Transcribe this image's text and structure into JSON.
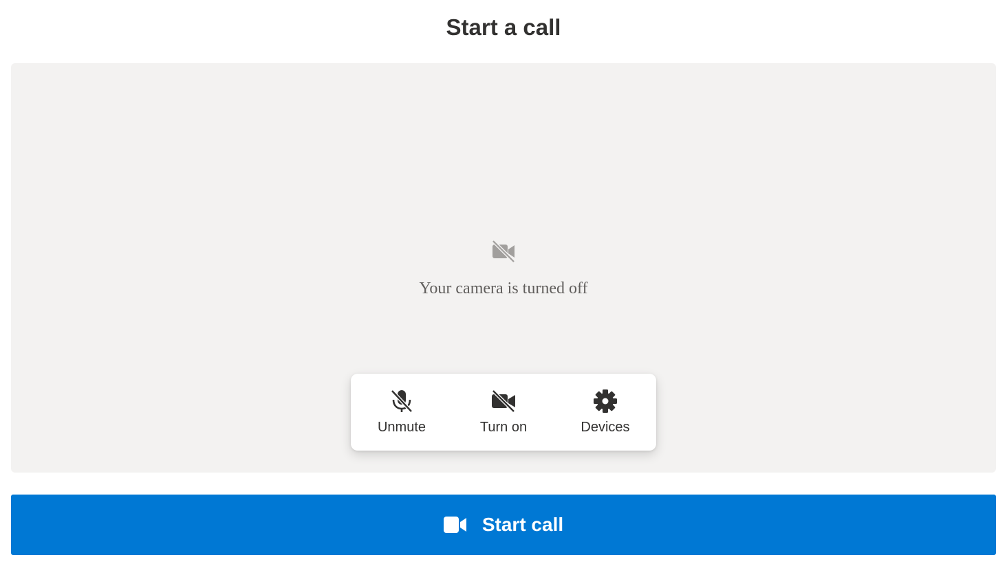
{
  "header": {
    "title": "Start a call"
  },
  "preview": {
    "icon": "camera-off-icon",
    "message": "Your camera is turned off"
  },
  "controls": {
    "microphone": {
      "label": "Unmute",
      "icon": "microphone-off-icon"
    },
    "camera": {
      "label": "Turn on",
      "icon": "camera-off-icon"
    },
    "devices": {
      "label": "Devices",
      "icon": "gear-icon"
    }
  },
  "start_call": {
    "label": "Start call",
    "icon": "video-camera-icon"
  },
  "colors": {
    "accent": "#0078d4",
    "preview_background": "#f3f2f1",
    "text_primary": "#323130",
    "text_secondary": "#605e5c",
    "icon_muted": "#a19f9d"
  }
}
